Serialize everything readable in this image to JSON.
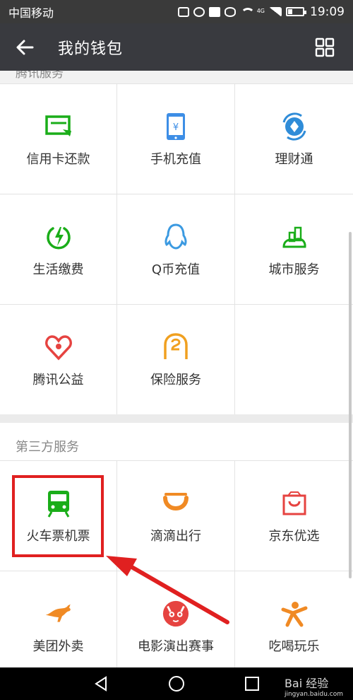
{
  "status_bar": {
    "carrier": "中国移动",
    "network": "4G",
    "battery_percent": 30,
    "time": "19:09"
  },
  "nav": {
    "title": "我的钱包"
  },
  "sections": [
    {
      "title": "腾讯服务",
      "items": [
        {
          "label": "信用卡还款",
          "icon": "credit-card-icon",
          "color": "#1aad19"
        },
        {
          "label": "手机充值",
          "icon": "mobile-topup-icon",
          "color": "#3d8ee6"
        },
        {
          "label": "理财通",
          "icon": "wealth-icon",
          "color": "#2f8cd8"
        },
        {
          "label": "生活缴费",
          "icon": "utility-bill-icon",
          "color": "#1aad19"
        },
        {
          "label": "Q币充值",
          "icon": "qq-penguin-icon",
          "color": "#3b9ae1"
        },
        {
          "label": "城市服务",
          "icon": "city-service-icon",
          "color": "#1aad19"
        },
        {
          "label": "腾讯公益",
          "icon": "charity-heart-icon",
          "color": "#e64340"
        },
        {
          "label": "保险服务",
          "icon": "insurance-icon",
          "color": "#f0a020"
        }
      ]
    },
    {
      "title": "第三方服务",
      "items": [
        {
          "label": "火车票机票",
          "icon": "train-icon",
          "color": "#1aad19"
        },
        {
          "label": "滴滴出行",
          "icon": "didi-icon",
          "color": "#f08a24"
        },
        {
          "label": "京东优选",
          "icon": "jd-bag-icon",
          "color": "#e64340"
        },
        {
          "label": "美团外卖",
          "icon": "kangaroo-icon",
          "color": "#f08a24"
        },
        {
          "label": "电影演出赛事",
          "icon": "cat-eye-icon",
          "color": "#e64340"
        },
        {
          "label": "吃喝玩乐",
          "icon": "person-icon",
          "color": "#f08a24"
        }
      ]
    }
  ],
  "watermark": {
    "brand": "Bai 经验",
    "domain": "jingyan.baidu.com"
  }
}
